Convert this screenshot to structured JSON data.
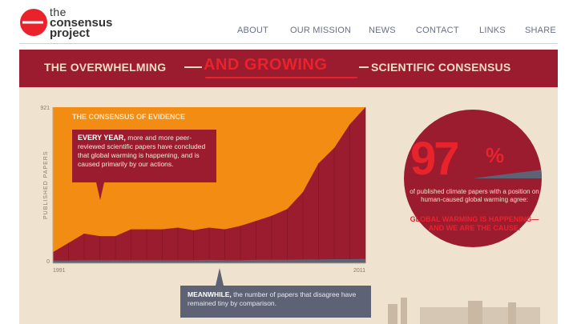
{
  "site": {
    "brand_line1": "the",
    "brand_line2": "consensus",
    "brand_line3": "project"
  },
  "nav": {
    "items": [
      {
        "label": "ABOUT"
      },
      {
        "label": "OUR MISSION"
      },
      {
        "label": "NEWS"
      },
      {
        "label": "CONTACT"
      },
      {
        "label": "LINKS"
      },
      {
        "label": "SHARE"
      }
    ]
  },
  "banner": {
    "left": "THE OVERWHELMING",
    "accent": "AND GROWING",
    "right": "SCIENTIFIC CONSENSUS"
  },
  "evidence": {
    "title": "THE CONSENSUS OF EVIDENCE",
    "ylabel": "PUBLISHED PAPERS",
    "callout_bold": "EVERY YEAR,",
    "callout_rest": "more and more peer-reviewed scientific papers have concluded that global warming is happening, and is caused primarily by our actions.",
    "meanwhile_bold": "MEANWHILE,",
    "meanwhile_rest": "the number of papers that disagree have remained tiny by comparison."
  },
  "consensus": {
    "percent": "97",
    "percent_sign": "%",
    "description": "of published climate papers with a position on human-caused global warming agree:",
    "cause": "GLOBAL WARMING IS HAPPENING—AND WE ARE THE CAUSE."
  },
  "colors": {
    "banner": "#9b1c2f",
    "accent_red": "#e8232c",
    "orange": "#f28c13",
    "slate": "#5e6275",
    "background": "#efe2cf"
  },
  "chart_data": {
    "type": "area",
    "title": "THE CONSENSUS OF EVIDENCE",
    "ylabel": "PUBLISHED PAPERS",
    "xlabel": "",
    "x": [
      1991,
      1992,
      1993,
      1994,
      1995,
      1996,
      1997,
      1998,
      1999,
      2000,
      2001,
      2002,
      2003,
      2004,
      2005,
      2006,
      2007,
      2008,
      2009,
      2010,
      2011
    ],
    "xlim": [
      1991,
      2011
    ],
    "ylim": [
      0,
      921
    ],
    "y_ticks": [
      "0",
      "921"
    ],
    "x_ticks": [
      "1991",
      "2011"
    ],
    "series": [
      {
        "values": [
          65,
          120,
          175,
          160,
          160,
          200,
          200,
          200,
          210,
          195,
          210,
          200,
          220,
          250,
          280,
          320,
          420,
          590,
          680,
          820,
          921
        ]
      },
      {
        "values": [
          1,
          1,
          2,
          2,
          2,
          2,
          2,
          2,
          2,
          2,
          3,
          2,
          2,
          3,
          3,
          3,
          4,
          4,
          5,
          5,
          6
        ]
      }
    ]
  }
}
